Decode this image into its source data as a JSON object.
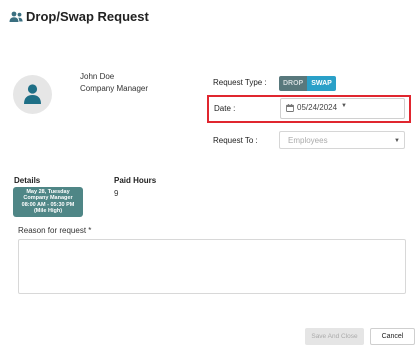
{
  "header": {
    "title": "Drop/Swap Request",
    "icon": "users-icon"
  },
  "user": {
    "name": "John Doe",
    "role": "Company Manager",
    "avatar_icon": "person-icon"
  },
  "request_type": {
    "label": "Request Type :",
    "options": [
      "DROP",
      "SWAP"
    ],
    "selected": "SWAP"
  },
  "date": {
    "label": "Date :",
    "value": "05/24/2024",
    "icon": "calendar-icon"
  },
  "request_to": {
    "label": "Request To :",
    "placeholder": "Employees"
  },
  "details": {
    "label": "Details",
    "shift_lines": [
      "May 28, Tuesday",
      "Company Manager",
      "08:00 AM - 05:30 PM",
      "(Mile High)"
    ]
  },
  "paid_hours": {
    "label": "Paid Hours",
    "value": "9"
  },
  "reason": {
    "label": "Reason for request *"
  },
  "footer": {
    "save_label": "Save And Close",
    "cancel_label": "Cancel"
  },
  "colors": {
    "highlight": "#e0262f",
    "swap_active": "#2aa0c8",
    "drop": "#58787c",
    "shift_card": "#4f8686"
  }
}
